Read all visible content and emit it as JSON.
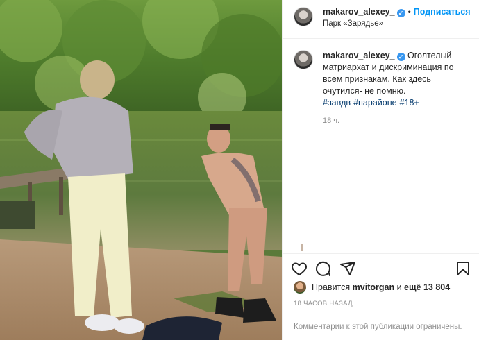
{
  "header": {
    "username": "makarov_alexey_",
    "verified_icon": "verified-badge-icon",
    "separator": "•",
    "follow_label": "Подписаться",
    "location": "Парк «Зарядье»"
  },
  "caption": {
    "username": "makarov_alexey_",
    "text": "Оголтелый матриархат и дискриминация по всем признакам. Как здесь очутился- не помню.",
    "hashtags": [
      "#завдв",
      "#нарайоне",
      "#18+"
    ],
    "time": "18 ч."
  },
  "actions": {
    "like_icon": "heart-icon",
    "comment_icon": "comment-icon",
    "share_icon": "share-icon",
    "save_icon": "bookmark-icon"
  },
  "likes": {
    "prefix": "Нравится",
    "user": "mvitorgan",
    "middle": "и",
    "count": "ещё 13 804"
  },
  "posted_ago": "18 ЧАСОВ НАЗАД",
  "comments_note": "Комментарии к этой публикации ограничены.",
  "colors": {
    "accent": "#0095f6",
    "verified": "#3897f0",
    "hashtag": "#00376b",
    "muted": "#8e8e8e"
  }
}
